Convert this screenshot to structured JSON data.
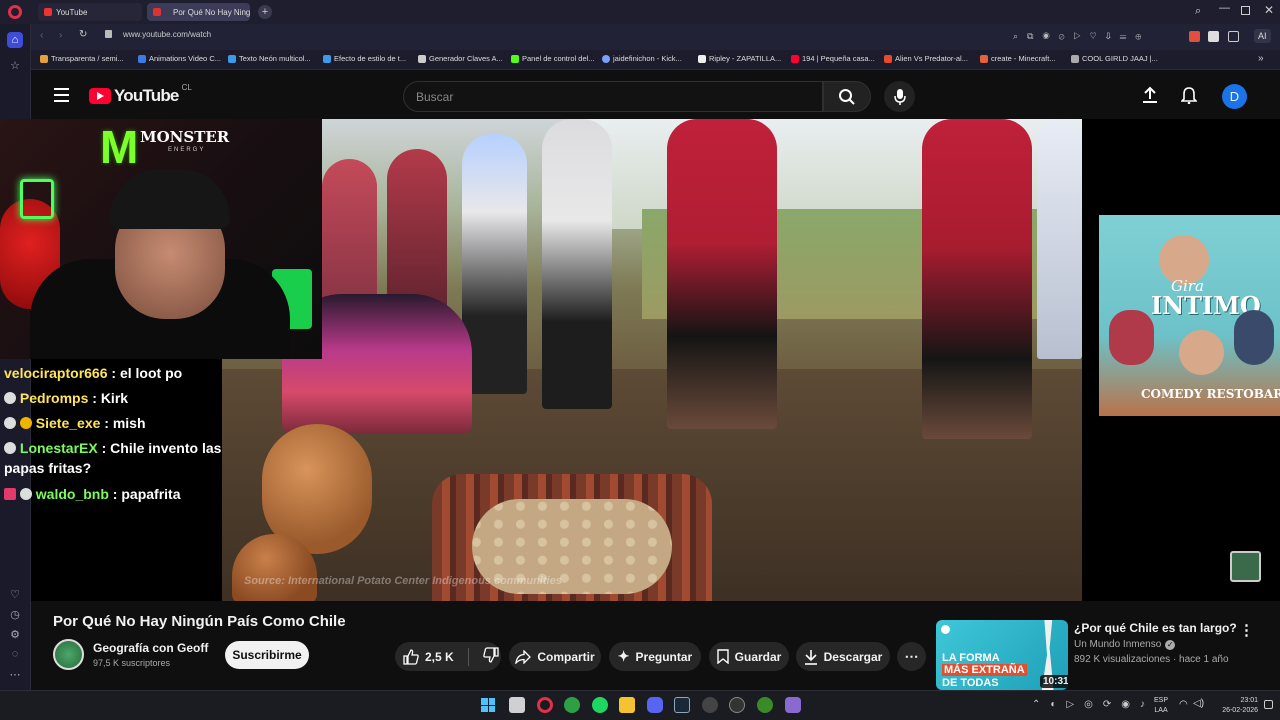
{
  "browser": {
    "tabs": [
      {
        "title": "YouTube",
        "active": false
      },
      {
        "title": "Por Qué No Hay Ningú",
        "active": true
      }
    ],
    "url": "www.youtube.com/watch",
    "ai_label": "AI",
    "bookmarks": [
      "Transparenta / semi...",
      "Animations Video C...",
      "Texto Neón multicol...",
      "Efecto de estilo de t...",
      "Generador Claves A...",
      "Panel de control del...",
      "jaidefinichon - Kick...",
      "Ripley - ZAPATILLA...",
      "194 | Pequeña casa...",
      "Alien Vs Predator-al...",
      "create - Minecraft...",
      "COOL GIRLD JAAJ |..."
    ]
  },
  "header": {
    "logo_text": "YouTube",
    "region": "CL",
    "search_placeholder": "Buscar",
    "avatar_letter": "D",
    "brand_color": "#ff0033"
  },
  "stream_overlay": {
    "sponsor": "MONSTER",
    "sponsor_sub": "ENERGY",
    "chat": [
      {
        "user": "velociraptor666",
        "msg": "el loot po",
        "color": "#ffe45c"
      },
      {
        "user": "Pedromps",
        "msg": "Kirk",
        "color": "#ffe45c"
      },
      {
        "user": "Siete_exe",
        "msg": "mish",
        "color": "#ffe45c"
      },
      {
        "user": "LonestarEX",
        "msg": "Chile invento las papas fritas?",
        "color": "#7cfc5c"
      },
      {
        "user": "waldo_bnb",
        "msg": "papafrita",
        "color": "#7cfc5c"
      }
    ],
    "poster_title": "INTIMO",
    "poster_script": "Gira",
    "poster_venue": "COMEDY RESTOBAR",
    "video_caption": "Source: International Potato Center Indigenous communities"
  },
  "video": {
    "title": "Por Qué No Hay Ningún País Como Chile",
    "channel": "Geografía con Geoff",
    "subscribers": "97,5 K suscriptores",
    "subscribe_label": "Suscribirme",
    "likes": "2,5 K",
    "share_label": "Compartir",
    "ask_label": "Preguntar",
    "save_label": "Guardar",
    "download_label": "Descargar"
  },
  "recommendation": {
    "title": "¿Por qué Chile es tan largo?",
    "channel": "Un Mundo Inmenso",
    "meta": "892 K visualizaciones · hace 1 año",
    "duration": "10:31",
    "thumb_line1": "LA FORMA",
    "thumb_line2": "MÁS EXTRAÑA",
    "thumb_line3": "DE TODAS"
  },
  "taskbar": {
    "lang": "ESP",
    "lang2": "LAA",
    "time": "23:01",
    "date": "26-02-2026"
  }
}
